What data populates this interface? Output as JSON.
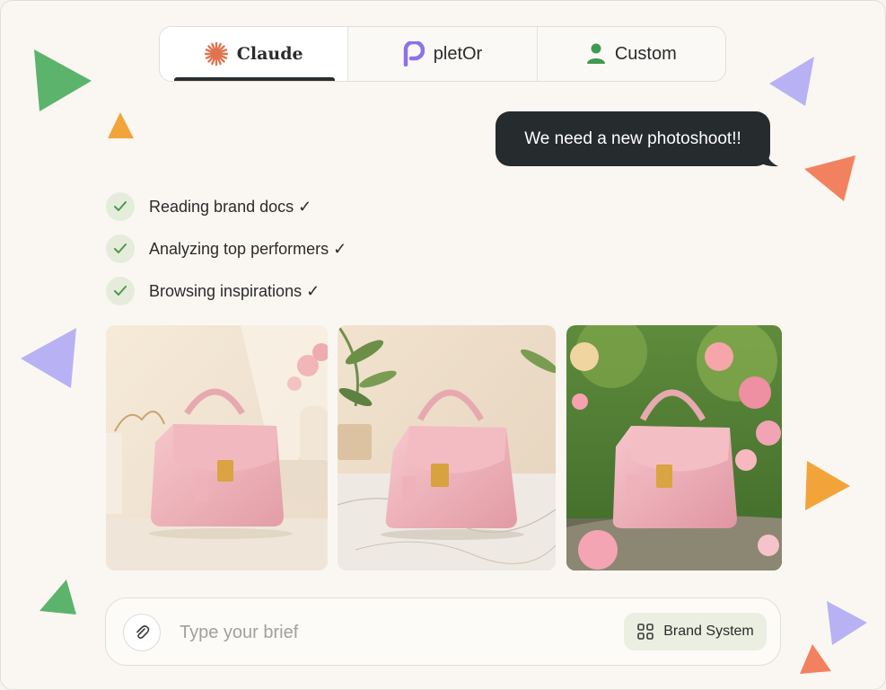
{
  "tabs": [
    {
      "label": "Claude",
      "icon": "claude-sunburst-icon",
      "color": "#e0734f",
      "active": true
    },
    {
      "label": "pletOr",
      "icon": "pletor-logo-icon",
      "color": "#8b72e8",
      "active": false
    },
    {
      "label": "Custom",
      "icon": "user-icon",
      "color": "#3f9b4f",
      "active": false
    }
  ],
  "chat": {
    "message": "We need a new photoshoot!!"
  },
  "steps": [
    {
      "label": "Reading brand docs ✓",
      "done": true
    },
    {
      "label": "Analyzing top performers ✓",
      "done": true
    },
    {
      "label": "Browsing inspirations ✓",
      "done": true
    }
  ],
  "composer": {
    "placeholder": "Type your brief",
    "value": "",
    "brand_button_label": "Brand System",
    "attach_icon": "paperclip-icon",
    "brand_icon": "grid-icon"
  },
  "colors": {
    "background": "#faf7f2",
    "bubble": "#262b2d",
    "check_bg": "#e6ecdc",
    "check_mark": "#4c9a49",
    "triangle_green": "#5cb46c",
    "triangle_orange": "#f2a33a",
    "triangle_purple": "#b8b2f4",
    "triangle_coral": "#f2825f"
  }
}
